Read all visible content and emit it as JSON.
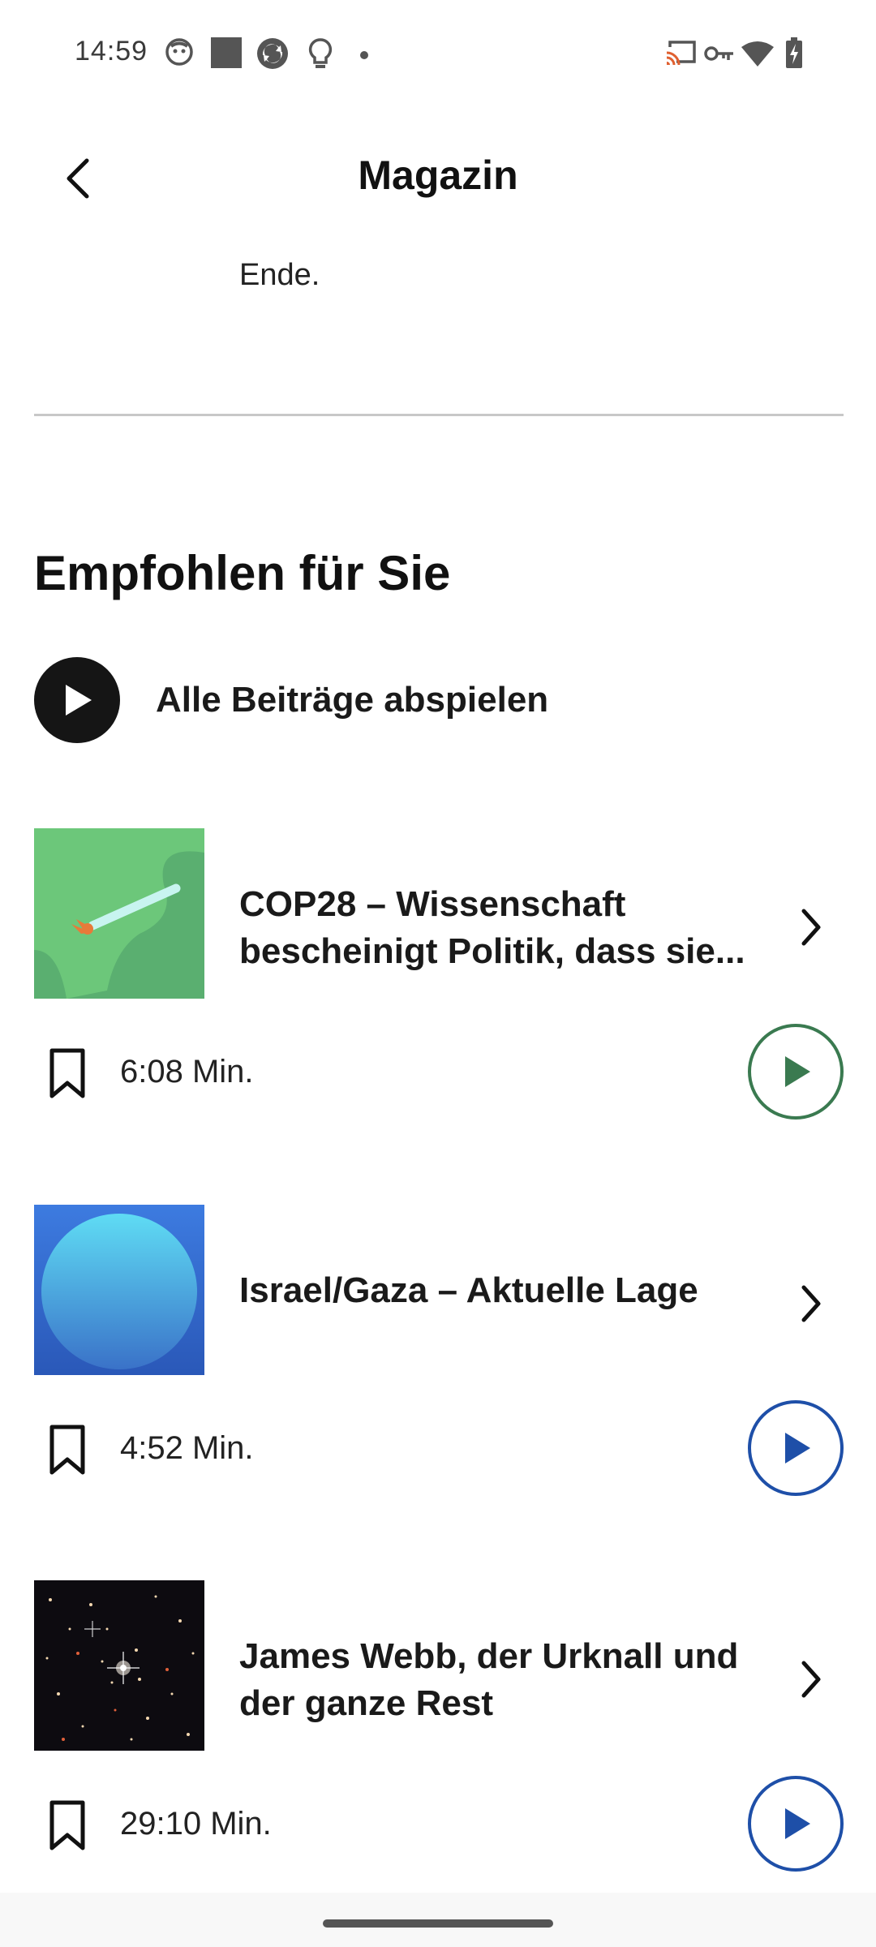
{
  "status_bar": {
    "time": "14:59",
    "left_icons": [
      "face-notification-icon",
      "square-notification-icon",
      "sync-notification-icon",
      "bulb-notification-icon",
      "dot-icon"
    ],
    "right_icons": [
      "cast-icon",
      "vpn-key-icon",
      "wifi-icon",
      "battery-charging-icon"
    ]
  },
  "header": {
    "title": "Magazin",
    "back_icon": "back-arrow-icon"
  },
  "previous_section": {
    "trailing_text": "Ende."
  },
  "recommendations": {
    "title": "Empfohlen für Sie",
    "play_all_label": "Alle Beiträge abspielen",
    "items": [
      {
        "title": "COP28 – Wissenschaft bescheinigt Politik, dass sie...",
        "duration": "6:08 Min.",
        "accent": "#3a7a50",
        "thumbnail": "cigarette-illustration"
      },
      {
        "title": "Israel/Gaza – Aktuelle Lage",
        "duration": "4:52 Min.",
        "accent": "#1e4fa8",
        "thumbnail": "blue-sphere-illustration"
      },
      {
        "title": "James Webb, der Urknall und der ganze Rest",
        "duration": "29:10 Min.",
        "accent": "#1e4fa8",
        "thumbnail": "deep-space-photo"
      }
    ]
  }
}
